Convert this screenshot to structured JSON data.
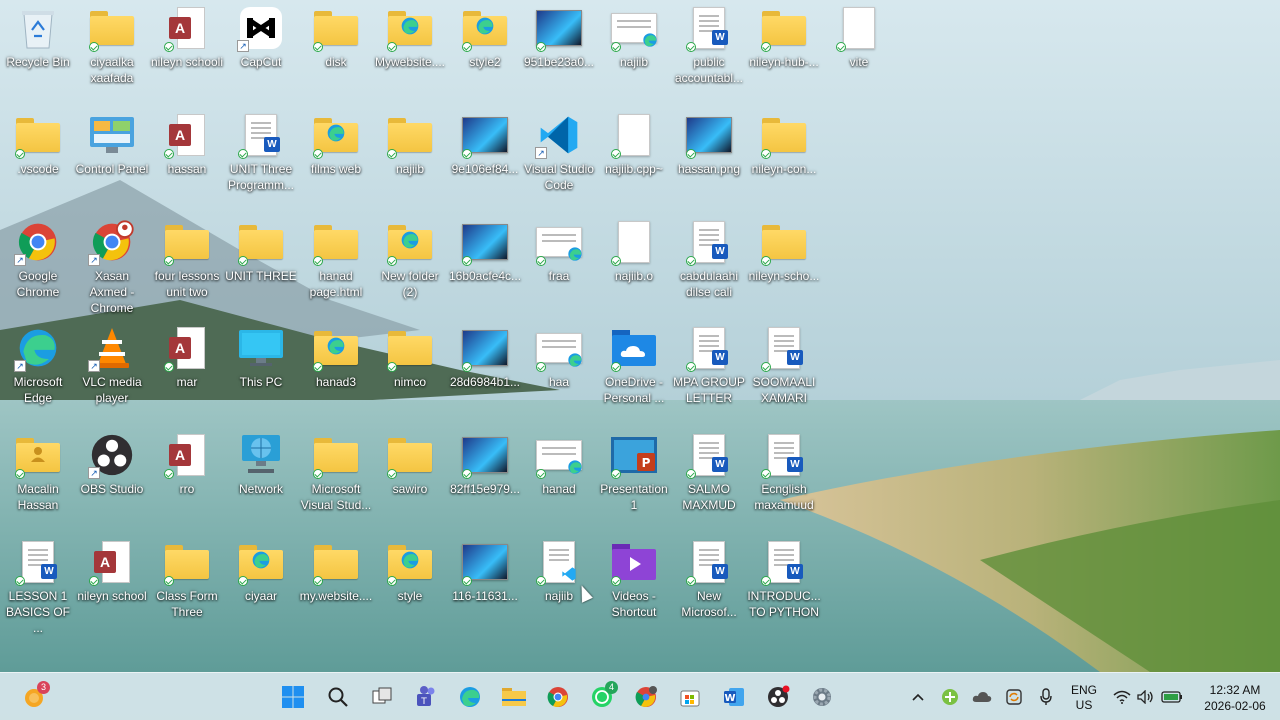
{
  "desktop_icons": [
    {
      "label": "Recycle Bin",
      "icon": "recycle-bin-icon",
      "col": 0,
      "row": 0
    },
    {
      "label": "ciyaalka xaafada",
      "icon": "folder-icon",
      "col": 1,
      "row": 0
    },
    {
      "label": "nileyn schooli",
      "icon": "access-file-icon",
      "col": 2,
      "row": 0
    },
    {
      "label": "CapCut",
      "icon": "capcut-icon",
      "col": 3,
      "row": 0
    },
    {
      "label": "disk",
      "icon": "folder-icon",
      "col": 4,
      "row": 0
    },
    {
      "label": "Mywebsite....",
      "icon": "folder-edge-icon",
      "col": 5,
      "row": 0
    },
    {
      "label": "style2",
      "icon": "folder-edge-icon",
      "col": 6,
      "row": 0
    },
    {
      "label": "951be23a0...",
      "icon": "image-file-icon",
      "col": 7,
      "row": 0
    },
    {
      "label": "najiib",
      "icon": "edge-document-icon",
      "col": 8,
      "row": 0
    },
    {
      "label": "public accountabl...",
      "icon": "word-document-icon",
      "col": 9,
      "row": 0
    },
    {
      "label": "nileyn-hub-...",
      "icon": "folder-icon",
      "col": 10,
      "row": 0
    },
    {
      "label": "vite",
      "icon": "blank-file-icon",
      "col": 11,
      "row": 0
    },
    {
      "label": ".vscode",
      "icon": "folder-icon",
      "col": 0,
      "row": 1
    },
    {
      "label": "Control Panel",
      "icon": "control-panel-icon",
      "col": 1,
      "row": 1
    },
    {
      "label": "hassan",
      "icon": "access-file-icon",
      "col": 2,
      "row": 1
    },
    {
      "label": "UNIT Three Programm...",
      "icon": "word-document-icon",
      "col": 3,
      "row": 1
    },
    {
      "label": "films web",
      "icon": "folder-edge-icon",
      "col": 4,
      "row": 1
    },
    {
      "label": "najiib",
      "icon": "folder-icon",
      "col": 5,
      "row": 1
    },
    {
      "label": "9e106ef84...",
      "icon": "image-file-icon",
      "col": 6,
      "row": 1
    },
    {
      "label": "Visual Studio Code",
      "icon": "vscode-icon",
      "col": 7,
      "row": 1
    },
    {
      "label": "najiib.cpp~",
      "icon": "blank-file-icon",
      "col": 8,
      "row": 1
    },
    {
      "label": "hassan.png",
      "icon": "image-file-icon",
      "col": 9,
      "row": 1
    },
    {
      "label": "nileyn-con...",
      "icon": "folder-icon",
      "col": 10,
      "row": 1
    },
    {
      "label": "Google Chrome",
      "icon": "chrome-icon",
      "col": 0,
      "row": 2
    },
    {
      "label": "Xasan Axmed - Chrome",
      "icon": "chrome-profile-icon",
      "col": 1,
      "row": 2
    },
    {
      "label": "four lessons unit two",
      "icon": "folder-icon",
      "col": 2,
      "row": 2
    },
    {
      "label": "UNIT THREE",
      "icon": "folder-icon",
      "col": 3,
      "row": 2
    },
    {
      "label": "hanad page.html",
      "icon": "folder-icon",
      "col": 4,
      "row": 2
    },
    {
      "label": "New folder (2)",
      "icon": "folder-edge-icon",
      "col": 5,
      "row": 2
    },
    {
      "label": "16b0acfe4c...",
      "icon": "image-file-icon",
      "col": 6,
      "row": 2
    },
    {
      "label": "fraa",
      "icon": "edge-document-icon",
      "col": 7,
      "row": 2
    },
    {
      "label": "najiib.o",
      "icon": "blank-file-icon",
      "col": 8,
      "row": 2
    },
    {
      "label": "cabdulaahi dilse cali",
      "icon": "word-document-icon",
      "col": 9,
      "row": 2
    },
    {
      "label": "nileyn-scho...",
      "icon": "folder-icon",
      "col": 10,
      "row": 2
    },
    {
      "label": "Microsoft Edge",
      "icon": "edge-icon",
      "col": 0,
      "row": 3
    },
    {
      "label": "VLC media player",
      "icon": "vlc-icon",
      "col": 1,
      "row": 3
    },
    {
      "label": "mar",
      "icon": "access-file-icon",
      "col": 2,
      "row": 3
    },
    {
      "label": "This PC",
      "icon": "this-pc-icon",
      "col": 3,
      "row": 3
    },
    {
      "label": "hanad3",
      "icon": "folder-edge-icon",
      "col": 4,
      "row": 3
    },
    {
      "label": "nimco",
      "icon": "folder-icon",
      "col": 5,
      "row": 3
    },
    {
      "label": "28d6984b1...",
      "icon": "image-file-icon",
      "col": 6,
      "row": 3
    },
    {
      "label": "haa",
      "icon": "edge-document-icon",
      "col": 7,
      "row": 3
    },
    {
      "label": "OneDrive - Personal ...",
      "icon": "onedrive-folder-icon",
      "col": 8,
      "row": 3
    },
    {
      "label": "MPA GROUP LETTER",
      "icon": "word-document-icon",
      "col": 9,
      "row": 3
    },
    {
      "label": "SOOMAALI XAMARI",
      "icon": "word-document-icon",
      "col": 10,
      "row": 3
    },
    {
      "label": "Macalin Hassan",
      "icon": "user-folder-icon",
      "col": 0,
      "row": 4
    },
    {
      "label": "OBS Studio",
      "icon": "obs-icon",
      "col": 1,
      "row": 4
    },
    {
      "label": "rro",
      "icon": "access-file-icon",
      "col": 2,
      "row": 4
    },
    {
      "label": "Network",
      "icon": "network-icon",
      "col": 3,
      "row": 4
    },
    {
      "label": "Microsoft Visual Stud...",
      "icon": "folder-icon",
      "col": 4,
      "row": 4
    },
    {
      "label": "sawiro",
      "icon": "folder-icon",
      "col": 5,
      "row": 4
    },
    {
      "label": "82ff15e979...",
      "icon": "image-file-icon",
      "col": 6,
      "row": 4
    },
    {
      "label": "hanad",
      "icon": "edge-document-icon",
      "col": 7,
      "row": 4
    },
    {
      "label": "Presentation1",
      "icon": "powerpoint-icon",
      "col": 8,
      "row": 4
    },
    {
      "label": "SALMO MAXMUD",
      "icon": "word-document-icon",
      "col": 9,
      "row": 4
    },
    {
      "label": "Ecnglish maxamuud",
      "icon": "word-document-icon",
      "col": 10,
      "row": 4
    },
    {
      "label": "LESSON 1 BASICS OF ...",
      "icon": "word-document-icon",
      "col": 0,
      "row": 5
    },
    {
      "label": "nileyn school",
      "icon": "access-file-icon",
      "col": 1,
      "row": 5
    },
    {
      "label": "Class Form Three",
      "icon": "folder-icon",
      "col": 2,
      "row": 5
    },
    {
      "label": "ciyaar",
      "icon": "folder-edge-icon",
      "col": 3,
      "row": 5
    },
    {
      "label": "my.website....",
      "icon": "folder-icon",
      "col": 4,
      "row": 5
    },
    {
      "label": "style",
      "icon": "folder-edge-icon",
      "col": 5,
      "row": 5
    },
    {
      "label": "116-11631...",
      "icon": "image-file-icon",
      "col": 6,
      "row": 5
    },
    {
      "label": "najiib",
      "icon": "vscode-document-icon",
      "col": 7,
      "row": 5
    },
    {
      "label": "Videos - Shortcut",
      "icon": "videos-folder-icon",
      "col": 8,
      "row": 5
    },
    {
      "label": "New Microsof...",
      "icon": "word-document-icon",
      "col": 9,
      "row": 5
    },
    {
      "label": "INTRODUC... TO PYTHON",
      "icon": "word-document-icon",
      "col": 10,
      "row": 5
    }
  ],
  "taskbar": {
    "weather_badge": "3",
    "apps": [
      {
        "name": "start-button",
        "icon": "windows-logo-icon"
      },
      {
        "name": "search-button",
        "icon": "search-icon"
      },
      {
        "name": "task-view-button",
        "icon": "task-view-icon"
      },
      {
        "name": "teams-button",
        "icon": "teams-icon"
      },
      {
        "name": "edge-taskbar-button",
        "icon": "edge-icon"
      },
      {
        "name": "file-explorer-button",
        "icon": "folder-icon"
      },
      {
        "name": "chrome-taskbar-button",
        "icon": "chrome-icon"
      },
      {
        "name": "whatsapp-button",
        "icon": "whatsapp-icon"
      },
      {
        "name": "chrome-profile-taskbar-button",
        "icon": "chrome-profile-icon"
      },
      {
        "name": "store-button",
        "icon": "store-icon"
      },
      {
        "name": "word-taskbar-button",
        "icon": "word-icon"
      },
      {
        "name": "obs-taskbar-button",
        "icon": "obs-icon"
      },
      {
        "name": "settings-button",
        "icon": "gear-icon"
      }
    ],
    "whatsapp_badge": "4",
    "language_line1": "ENG",
    "language_line2": "US",
    "time": "12:32 AM",
    "date": "2026-02-06"
  },
  "colors": {
    "folder": "#f4c542",
    "word": "#185abd",
    "access": "#a4373a",
    "taskbar": "#d6e6ec"
  }
}
